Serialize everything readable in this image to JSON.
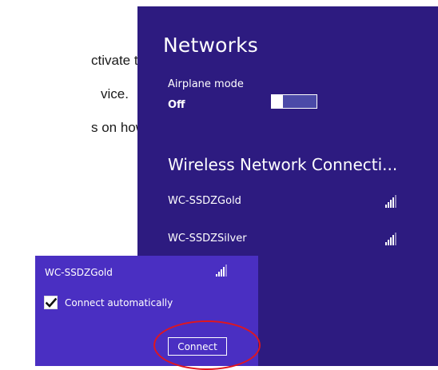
{
  "background_doc": {
    "line1": "ctivate the",
    "line2": "vice.",
    "line3": "s on how to"
  },
  "networks_panel": {
    "title": "Networks",
    "airplane_label": "Airplane mode",
    "airplane_value": "Off",
    "airplane_toggle_on": false,
    "section_title": "Wireless Network Connecti...",
    "networks": [
      {
        "name": "WC-SSDZGold",
        "icon": "wifi-signal-icon"
      },
      {
        "name": "WC-SSDZSilver",
        "icon": "wifi-signal-icon"
      }
    ]
  },
  "connect_popup": {
    "network_name": "WC-SSDZGold",
    "auto_checked": true,
    "auto_label": "Connect automatically",
    "connect_label": "Connect"
  },
  "colors": {
    "panel_bg": "#2d1b80",
    "popup_bg": "#4a2fc2",
    "highlight": "#e0161e"
  }
}
